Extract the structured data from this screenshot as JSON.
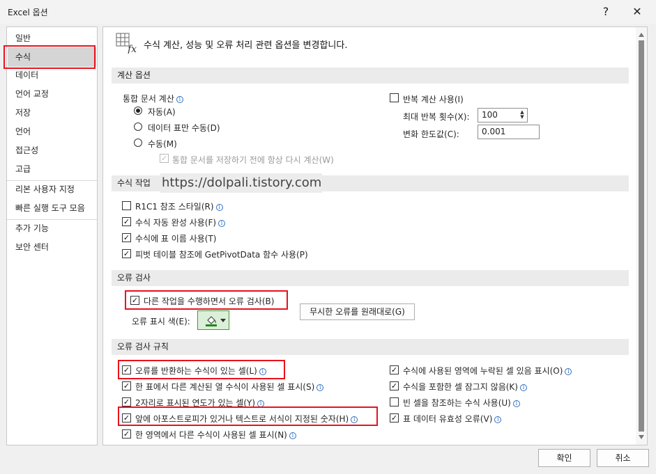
{
  "window": {
    "title": "Excel 옵션",
    "help": "?",
    "close": "✕"
  },
  "sidebar": {
    "items": [
      {
        "label": "일반"
      },
      {
        "label": "수식"
      },
      {
        "label": "데이터"
      },
      {
        "label": "언어 교정"
      },
      {
        "label": "저장"
      },
      {
        "label": "언어"
      },
      {
        "label": "접근성"
      },
      {
        "label": "고급"
      },
      {
        "label": "리본 사용자 지정"
      },
      {
        "label": "빠른 실행 도구 모음"
      },
      {
        "label": "추가 기능"
      },
      {
        "label": "보안 센터"
      }
    ],
    "active": "수식"
  },
  "header": {
    "text": "수식 계산, 성능 및 오류 처리 관련 옵션을 변경합니다.",
    "icon": "formula-fx-icon"
  },
  "calc": {
    "title": "계산 옵션",
    "workbook_label": "통합 문서 계산",
    "radios": [
      "자동(A)",
      "데이터 표만 수동(D)",
      "수동(M)"
    ],
    "selected": "자동(A)",
    "recalc_before_save": "통합 문서를 저장하기 전에 항상 다시 계산(W)",
    "iterative": "반복 계산 사용(I)",
    "max_iter_label": "최대 반복 횟수(X):",
    "max_iter_value": "100",
    "max_change_label": "변화 한도값(C):",
    "max_change_value": "0.001"
  },
  "formulas": {
    "title": "수식 작업",
    "items": [
      {
        "label": "R1C1 참조 스타일(R)",
        "checked": false
      },
      {
        "label": "수식 자동 완성 사용(F)",
        "checked": true
      },
      {
        "label": "수식에 표 이름 사용(T)",
        "checked": true
      },
      {
        "label": "피벗 테이블 참조에 GetPivotData 함수 사용(P)",
        "checked": true
      }
    ]
  },
  "watermark": "https://dolpali.tistory.com",
  "errcheck": {
    "title": "오류 검사",
    "enable": "다른 작업을 수행하면서 오류 검사(B)",
    "color_label": "오류 표시 색(E):",
    "reset_button": "무시한 오류를 원래대로(G)",
    "indicator_color": "#1e8b1e"
  },
  "rules": {
    "title": "오류 검사 규칙",
    "left": [
      {
        "label": "오류를 반환하는 수식이 있는 셀(L)",
        "checked": true
      },
      {
        "label": "한 표에서 다른 계산된 열 수식이 사용된 셀 표시(S)",
        "checked": true
      },
      {
        "label": "2자리로 표시된 연도가 있는 셀(Y)",
        "checked": true
      },
      {
        "label": "앞에 아포스트로피가 있거나 텍스트로 서식이 지정된 숫자(H)",
        "checked": true
      },
      {
        "label": "한 영역에서 다른 수식이 사용된 셀 표시(N)",
        "checked": true
      }
    ],
    "right": [
      {
        "label": "수식에 사용된 영역에 누락된 셀 있음 표시(O)",
        "checked": true
      },
      {
        "label": "수식을 포함한 셀 잠그지 않음(K)",
        "checked": true
      },
      {
        "label": "빈 셀을 참조하는 수식 사용(U)",
        "checked": false
      },
      {
        "label": "표 데이터 유효성 오류(V)",
        "checked": true
      }
    ]
  },
  "footer": {
    "ok": "확인",
    "cancel": "취소"
  },
  "colors": {
    "highlight": "#e8121d",
    "link_info": "#2f6fc0"
  }
}
